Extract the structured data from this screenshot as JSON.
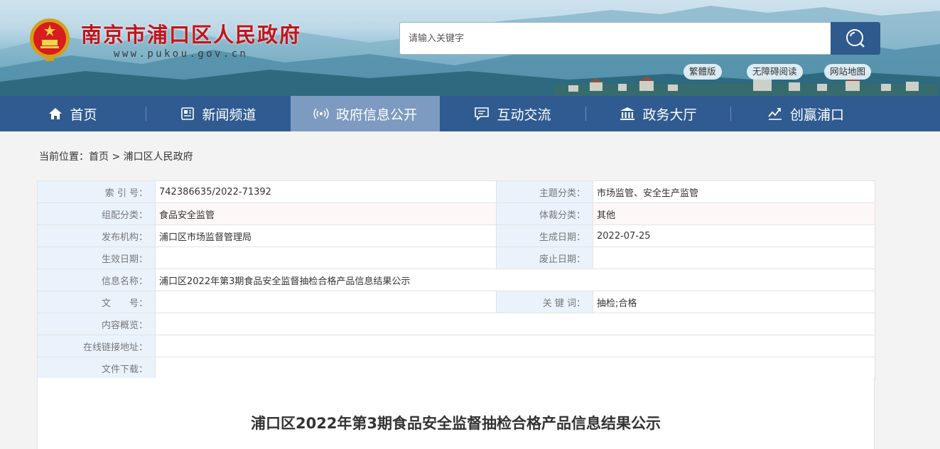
{
  "header": {
    "site_title": "南京市浦口区人民政府",
    "site_url": "www.pukou.gov.cn",
    "search": {
      "placeholder": "请输入关键字"
    },
    "quick_links": [
      "繁體版",
      "无障碍阅读",
      "网站地图"
    ]
  },
  "nav": {
    "items": [
      {
        "label": "首页",
        "icon": "home-icon"
      },
      {
        "label": "新闻频道",
        "icon": "news-icon"
      },
      {
        "label": "政府信息公开",
        "icon": "broadcast-icon"
      },
      {
        "label": "互动交流",
        "icon": "chat-icon"
      },
      {
        "label": "政务大厅",
        "icon": "government-building-icon"
      },
      {
        "label": "创赢浦口",
        "icon": "chart-icon"
      }
    ],
    "active_index": 2
  },
  "breadcrumb": {
    "prefix": "当前位置：",
    "items": [
      "首页",
      "浦口区人民政府"
    ],
    "separator": ">"
  },
  "meta": {
    "index_no": {
      "label": "索 引 号：",
      "value": "742386635/2022-71392"
    },
    "topic": {
      "label": "主题分类：",
      "value": "市场监管、安全生产监管"
    },
    "group": {
      "label": "组配分类：",
      "value": "食品安全监管"
    },
    "genre": {
      "label": "体裁分类：",
      "value": "其他"
    },
    "publisher": {
      "label": "发布机构：",
      "value": "浦口区市场监督管理局"
    },
    "created": {
      "label": "生成日期：",
      "value": "2022-07-25"
    },
    "effective": {
      "label": "生效日期：",
      "value": ""
    },
    "expired": {
      "label": "废止日期：",
      "value": ""
    },
    "info_name": {
      "label": "信息名称：",
      "value": "浦口区2022年第3期食品安全监督抽检合格产品信息结果公示"
    },
    "doc_no": {
      "label": "文　　号：",
      "value": ""
    },
    "keywords": {
      "label": "关 键 词：",
      "value": "抽检;合格"
    },
    "summary": {
      "label": "内容概览：",
      "value": ""
    },
    "online_link": {
      "label": "在线链接地址：",
      "value": ""
    },
    "download": {
      "label": "文件下载：",
      "value": ""
    }
  },
  "article": {
    "title": "浦口区2022年第3期食品安全监督抽检合格产品信息结果公示"
  },
  "colors": {
    "nav_bg": "#2f5b91",
    "nav_active": "#7d9bc0",
    "title_red": "#c4141b",
    "label_bg": "#eaf3fb"
  }
}
